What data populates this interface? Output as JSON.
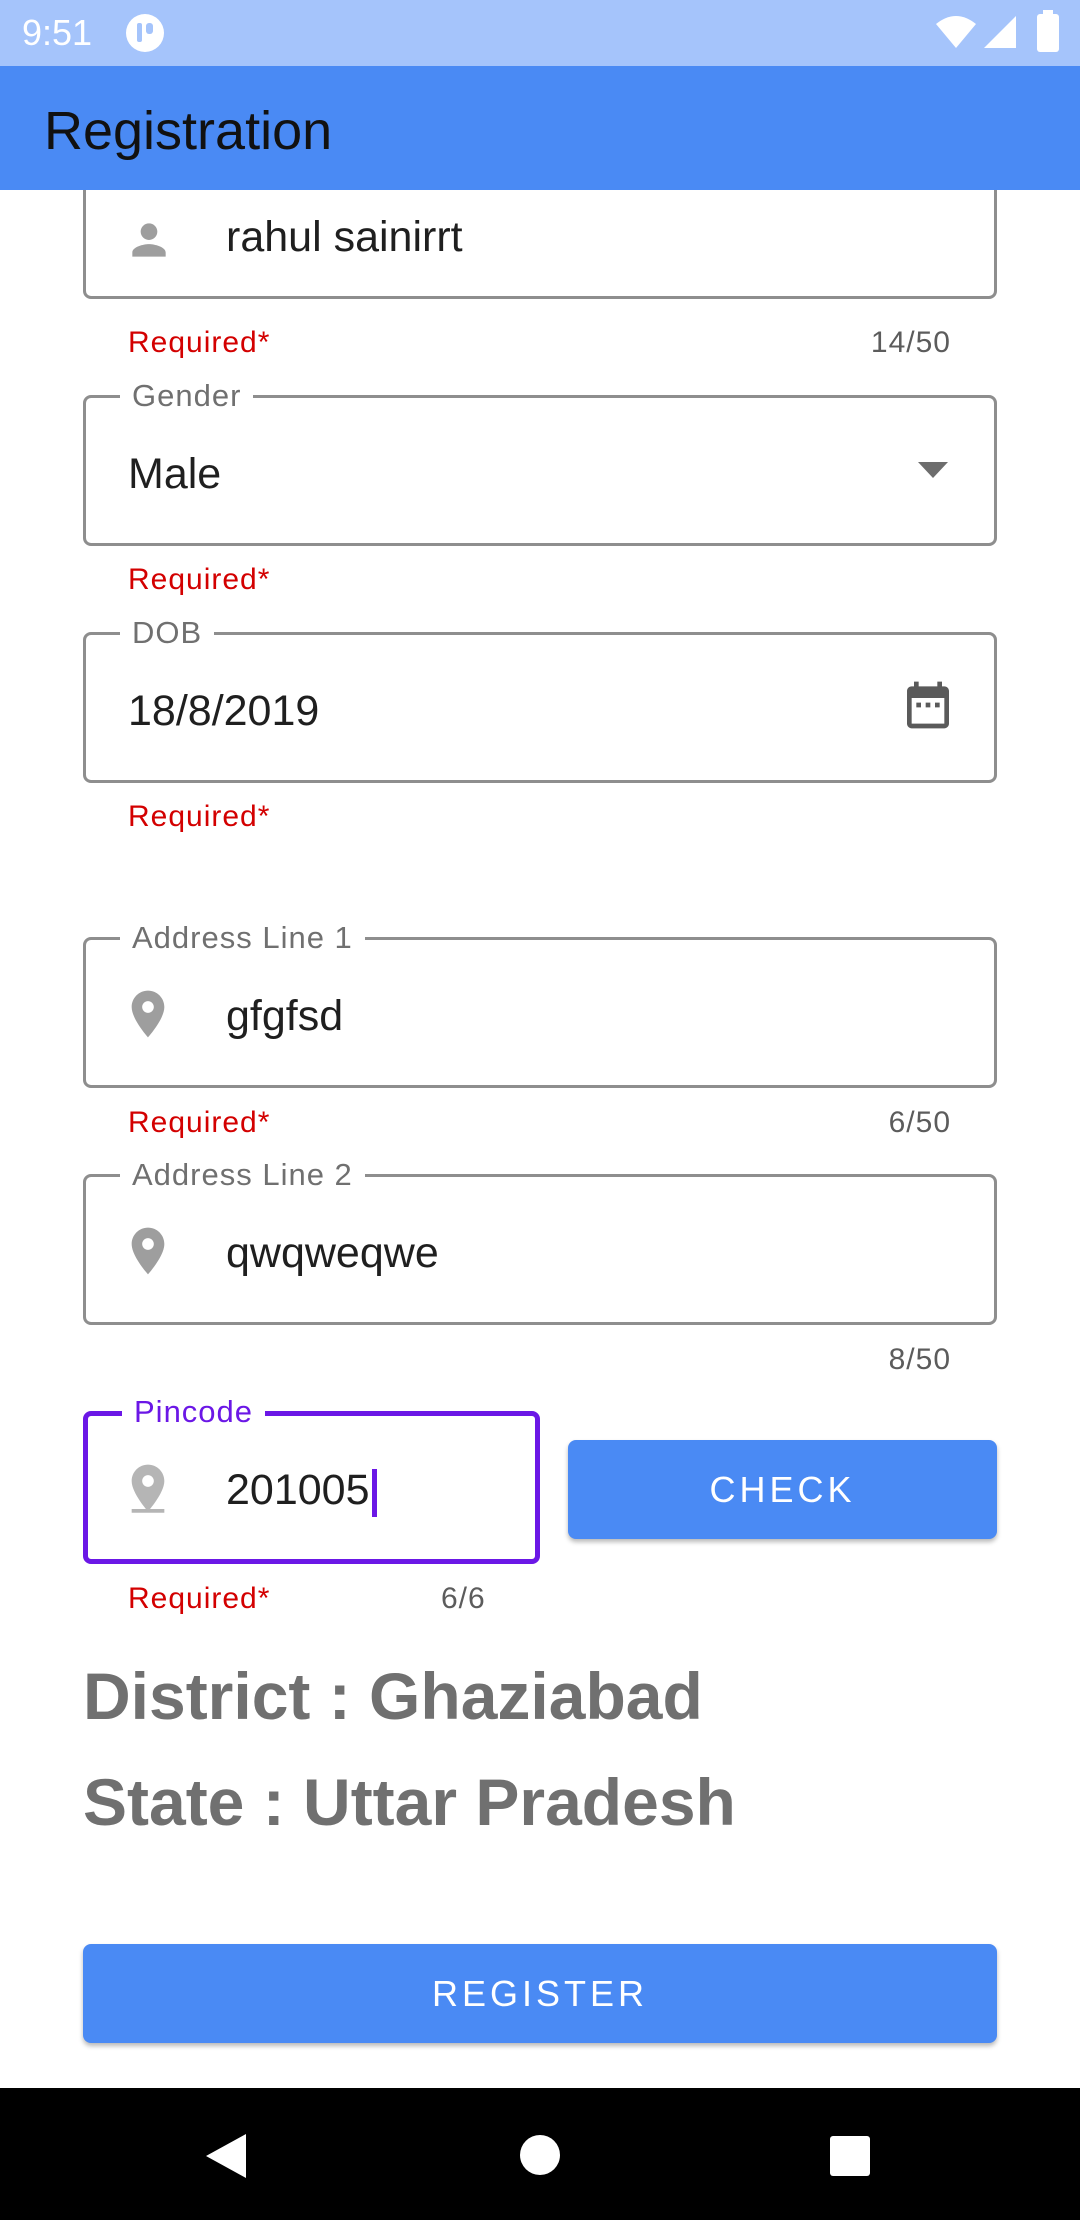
{
  "status_bar": {
    "time": "9:51",
    "background": "#a5c4fb",
    "icons": [
      "notification-icon",
      "wifi-icon",
      "signal-icon",
      "battery-icon"
    ]
  },
  "app_bar": {
    "title": "Registration",
    "background": "#4a8af4"
  },
  "form": {
    "name": {
      "value": "rahul sainirrt",
      "helper": "Required*",
      "counter": "14/50",
      "icon": "person-icon"
    },
    "gender": {
      "label": "Gender",
      "value": "Male",
      "helper": "Required*",
      "icon": "dropdown-arrow-icon"
    },
    "dob": {
      "label": "DOB",
      "value": "18/8/2019",
      "helper": "Required*",
      "icon": "calendar-icon"
    },
    "address1": {
      "label": "Address Line 1",
      "value": "gfgfsd",
      "helper": "Required*",
      "counter": "6/50",
      "icon": "location-pin-icon"
    },
    "address2": {
      "label": "Address Line 2",
      "value": "qwqweqwe",
      "counter": "8/50",
      "icon": "location-pin-icon"
    },
    "pincode": {
      "label": "Pincode",
      "value": "201005",
      "helper": "Required*",
      "counter": "6/6",
      "icon": "location-pin-icon"
    },
    "check_button": "CHECK",
    "district_text": "District : Ghaziabad",
    "state_text": "State : Uttar Pradesh",
    "register_button": "REGISTER"
  },
  "colors": {
    "accent": "#4a8af4",
    "focus": "#6b17e6",
    "error": "#d30000"
  },
  "nav_bar": {
    "icons": [
      "back-icon",
      "home-icon",
      "recents-icon"
    ]
  }
}
